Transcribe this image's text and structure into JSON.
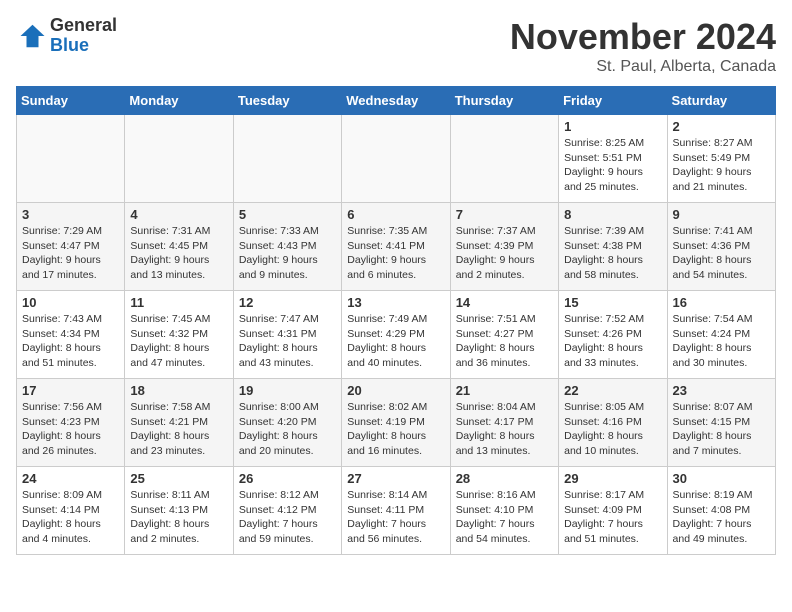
{
  "header": {
    "logo_general": "General",
    "logo_blue": "Blue",
    "month_title": "November 2024",
    "location": "St. Paul, Alberta, Canada"
  },
  "days_of_week": [
    "Sunday",
    "Monday",
    "Tuesday",
    "Wednesday",
    "Thursday",
    "Friday",
    "Saturday"
  ],
  "weeks": [
    [
      {
        "day": "",
        "info": ""
      },
      {
        "day": "",
        "info": ""
      },
      {
        "day": "",
        "info": ""
      },
      {
        "day": "",
        "info": ""
      },
      {
        "day": "",
        "info": ""
      },
      {
        "day": "1",
        "info": "Sunrise: 8:25 AM\nSunset: 5:51 PM\nDaylight: 9 hours and 25 minutes."
      },
      {
        "day": "2",
        "info": "Sunrise: 8:27 AM\nSunset: 5:49 PM\nDaylight: 9 hours and 21 minutes."
      }
    ],
    [
      {
        "day": "3",
        "info": "Sunrise: 7:29 AM\nSunset: 4:47 PM\nDaylight: 9 hours and 17 minutes."
      },
      {
        "day": "4",
        "info": "Sunrise: 7:31 AM\nSunset: 4:45 PM\nDaylight: 9 hours and 13 minutes."
      },
      {
        "day": "5",
        "info": "Sunrise: 7:33 AM\nSunset: 4:43 PM\nDaylight: 9 hours and 9 minutes."
      },
      {
        "day": "6",
        "info": "Sunrise: 7:35 AM\nSunset: 4:41 PM\nDaylight: 9 hours and 6 minutes."
      },
      {
        "day": "7",
        "info": "Sunrise: 7:37 AM\nSunset: 4:39 PM\nDaylight: 9 hours and 2 minutes."
      },
      {
        "day": "8",
        "info": "Sunrise: 7:39 AM\nSunset: 4:38 PM\nDaylight: 8 hours and 58 minutes."
      },
      {
        "day": "9",
        "info": "Sunrise: 7:41 AM\nSunset: 4:36 PM\nDaylight: 8 hours and 54 minutes."
      }
    ],
    [
      {
        "day": "10",
        "info": "Sunrise: 7:43 AM\nSunset: 4:34 PM\nDaylight: 8 hours and 51 minutes."
      },
      {
        "day": "11",
        "info": "Sunrise: 7:45 AM\nSunset: 4:32 PM\nDaylight: 8 hours and 47 minutes."
      },
      {
        "day": "12",
        "info": "Sunrise: 7:47 AM\nSunset: 4:31 PM\nDaylight: 8 hours and 43 minutes."
      },
      {
        "day": "13",
        "info": "Sunrise: 7:49 AM\nSunset: 4:29 PM\nDaylight: 8 hours and 40 minutes."
      },
      {
        "day": "14",
        "info": "Sunrise: 7:51 AM\nSunset: 4:27 PM\nDaylight: 8 hours and 36 minutes."
      },
      {
        "day": "15",
        "info": "Sunrise: 7:52 AM\nSunset: 4:26 PM\nDaylight: 8 hours and 33 minutes."
      },
      {
        "day": "16",
        "info": "Sunrise: 7:54 AM\nSunset: 4:24 PM\nDaylight: 8 hours and 30 minutes."
      }
    ],
    [
      {
        "day": "17",
        "info": "Sunrise: 7:56 AM\nSunset: 4:23 PM\nDaylight: 8 hours and 26 minutes."
      },
      {
        "day": "18",
        "info": "Sunrise: 7:58 AM\nSunset: 4:21 PM\nDaylight: 8 hours and 23 minutes."
      },
      {
        "day": "19",
        "info": "Sunrise: 8:00 AM\nSunset: 4:20 PM\nDaylight: 8 hours and 20 minutes."
      },
      {
        "day": "20",
        "info": "Sunrise: 8:02 AM\nSunset: 4:19 PM\nDaylight: 8 hours and 16 minutes."
      },
      {
        "day": "21",
        "info": "Sunrise: 8:04 AM\nSunset: 4:17 PM\nDaylight: 8 hours and 13 minutes."
      },
      {
        "day": "22",
        "info": "Sunrise: 8:05 AM\nSunset: 4:16 PM\nDaylight: 8 hours and 10 minutes."
      },
      {
        "day": "23",
        "info": "Sunrise: 8:07 AM\nSunset: 4:15 PM\nDaylight: 8 hours and 7 minutes."
      }
    ],
    [
      {
        "day": "24",
        "info": "Sunrise: 8:09 AM\nSunset: 4:14 PM\nDaylight: 8 hours and 4 minutes."
      },
      {
        "day": "25",
        "info": "Sunrise: 8:11 AM\nSunset: 4:13 PM\nDaylight: 8 hours and 2 minutes."
      },
      {
        "day": "26",
        "info": "Sunrise: 8:12 AM\nSunset: 4:12 PM\nDaylight: 7 hours and 59 minutes."
      },
      {
        "day": "27",
        "info": "Sunrise: 8:14 AM\nSunset: 4:11 PM\nDaylight: 7 hours and 56 minutes."
      },
      {
        "day": "28",
        "info": "Sunrise: 8:16 AM\nSunset: 4:10 PM\nDaylight: 7 hours and 54 minutes."
      },
      {
        "day": "29",
        "info": "Sunrise: 8:17 AM\nSunset: 4:09 PM\nDaylight: 7 hours and 51 minutes."
      },
      {
        "day": "30",
        "info": "Sunrise: 8:19 AM\nSunset: 4:08 PM\nDaylight: 7 hours and 49 minutes."
      }
    ]
  ]
}
